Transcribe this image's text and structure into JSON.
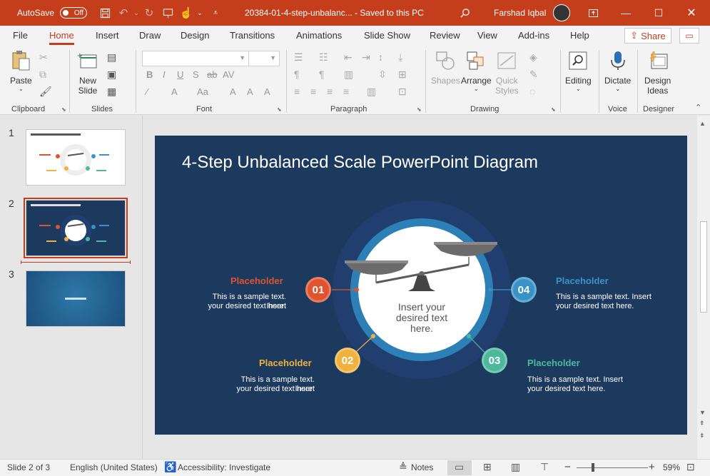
{
  "titlebar": {
    "autosave_label": "AutoSave",
    "autosave_state": "Off",
    "doc_title": "20384-01-4-step-unbalanc...  -  Saved to this PC",
    "user_name": "Farshad Iqbal"
  },
  "tabs": [
    {
      "label": "File"
    },
    {
      "label": "Home"
    },
    {
      "label": "Insert"
    },
    {
      "label": "Draw"
    },
    {
      "label": "Design"
    },
    {
      "label": "Transitions"
    },
    {
      "label": "Animations"
    },
    {
      "label": "Slide Show"
    },
    {
      "label": "Review"
    },
    {
      "label": "View"
    },
    {
      "label": "Add-ins"
    },
    {
      "label": "Help"
    }
  ],
  "share_label": "Share",
  "ribbon": {
    "paste": "Paste",
    "new_slide_1": "New",
    "new_slide_2": "Slide",
    "shapes": "Shapes",
    "arrange": "Arrange",
    "quick_styles_1": "Quick",
    "quick_styles_2": "Styles",
    "editing": "Editing",
    "dictate": "Dictate",
    "design_ideas_1": "Design",
    "design_ideas_2": "Ideas",
    "groups": {
      "clipboard": "Clipboard",
      "slides": "Slides",
      "font": "Font",
      "paragraph": "Paragraph",
      "drawing": "Drawing",
      "voice": "Voice",
      "designer": "Designer"
    }
  },
  "thumbnails": [
    {
      "num": "1"
    },
    {
      "num": "2"
    },
    {
      "num": "3"
    }
  ],
  "slide": {
    "title": "4-Step Unbalanced Scale PowerPoint Diagram",
    "center_text": "Insert your desired text here.",
    "steps": [
      {
        "num": "01",
        "title": "Placeholder",
        "text_1": "This is a sample text. Insert",
        "text_2": "your desired text here.",
        "color": "#e0532f"
      },
      {
        "num": "02",
        "title": "Placeholder",
        "text_1": "This is a sample text. Insert",
        "text_2": "your desired text here.",
        "color": "#f0b23e"
      },
      {
        "num": "03",
        "title": "Placeholder",
        "text_1": "This is a sample text. Insert",
        "text_2": "your desired text here.",
        "color": "#4db89b"
      },
      {
        "num": "04",
        "title": "Placeholder",
        "text_1": "This is a sample text. Insert",
        "text_2": "your desired text here.",
        "color": "#3a93c6"
      }
    ]
  },
  "statusbar": {
    "slide_info": "Slide 2 of 3",
    "language": "English (United States)",
    "accessibility": "Accessibility: Investigate",
    "notes": "Notes",
    "zoom": "59%"
  }
}
